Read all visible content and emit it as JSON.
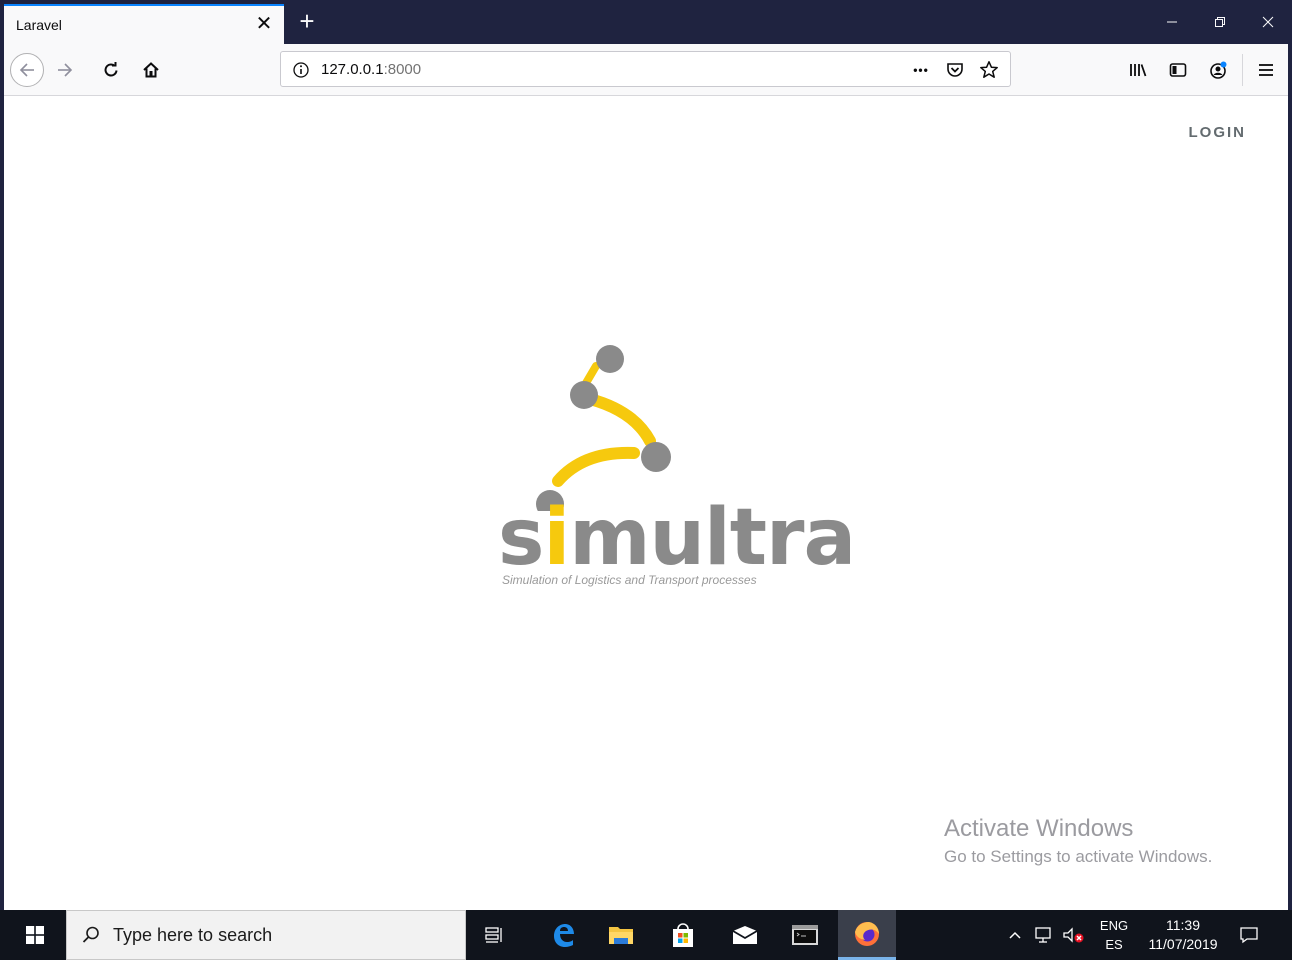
{
  "browser": {
    "tab": {
      "title": "Laravel",
      "close_glyph": "✕"
    },
    "new_tab_glyph": "+",
    "url": {
      "host": "127.0.0.1",
      "port": ":8000",
      "more_glyph": "•••"
    }
  },
  "page": {
    "login_label": "LOGIN",
    "logo": {
      "word_s": "s",
      "word_i": "i",
      "word_rest": "multra",
      "tagline": "Simulation of Logistics and Transport processes",
      "colors": {
        "gray": "#8a8a8a",
        "yellow": "#f6c90e"
      }
    }
  },
  "watermark": {
    "title": "Activate Windows",
    "subtitle": "Go to Settings to activate Windows."
  },
  "taskbar": {
    "search_placeholder": "Type here to search",
    "language": "ENG",
    "layout": "ES",
    "time": "11:39",
    "date": "11/07/2019"
  }
}
